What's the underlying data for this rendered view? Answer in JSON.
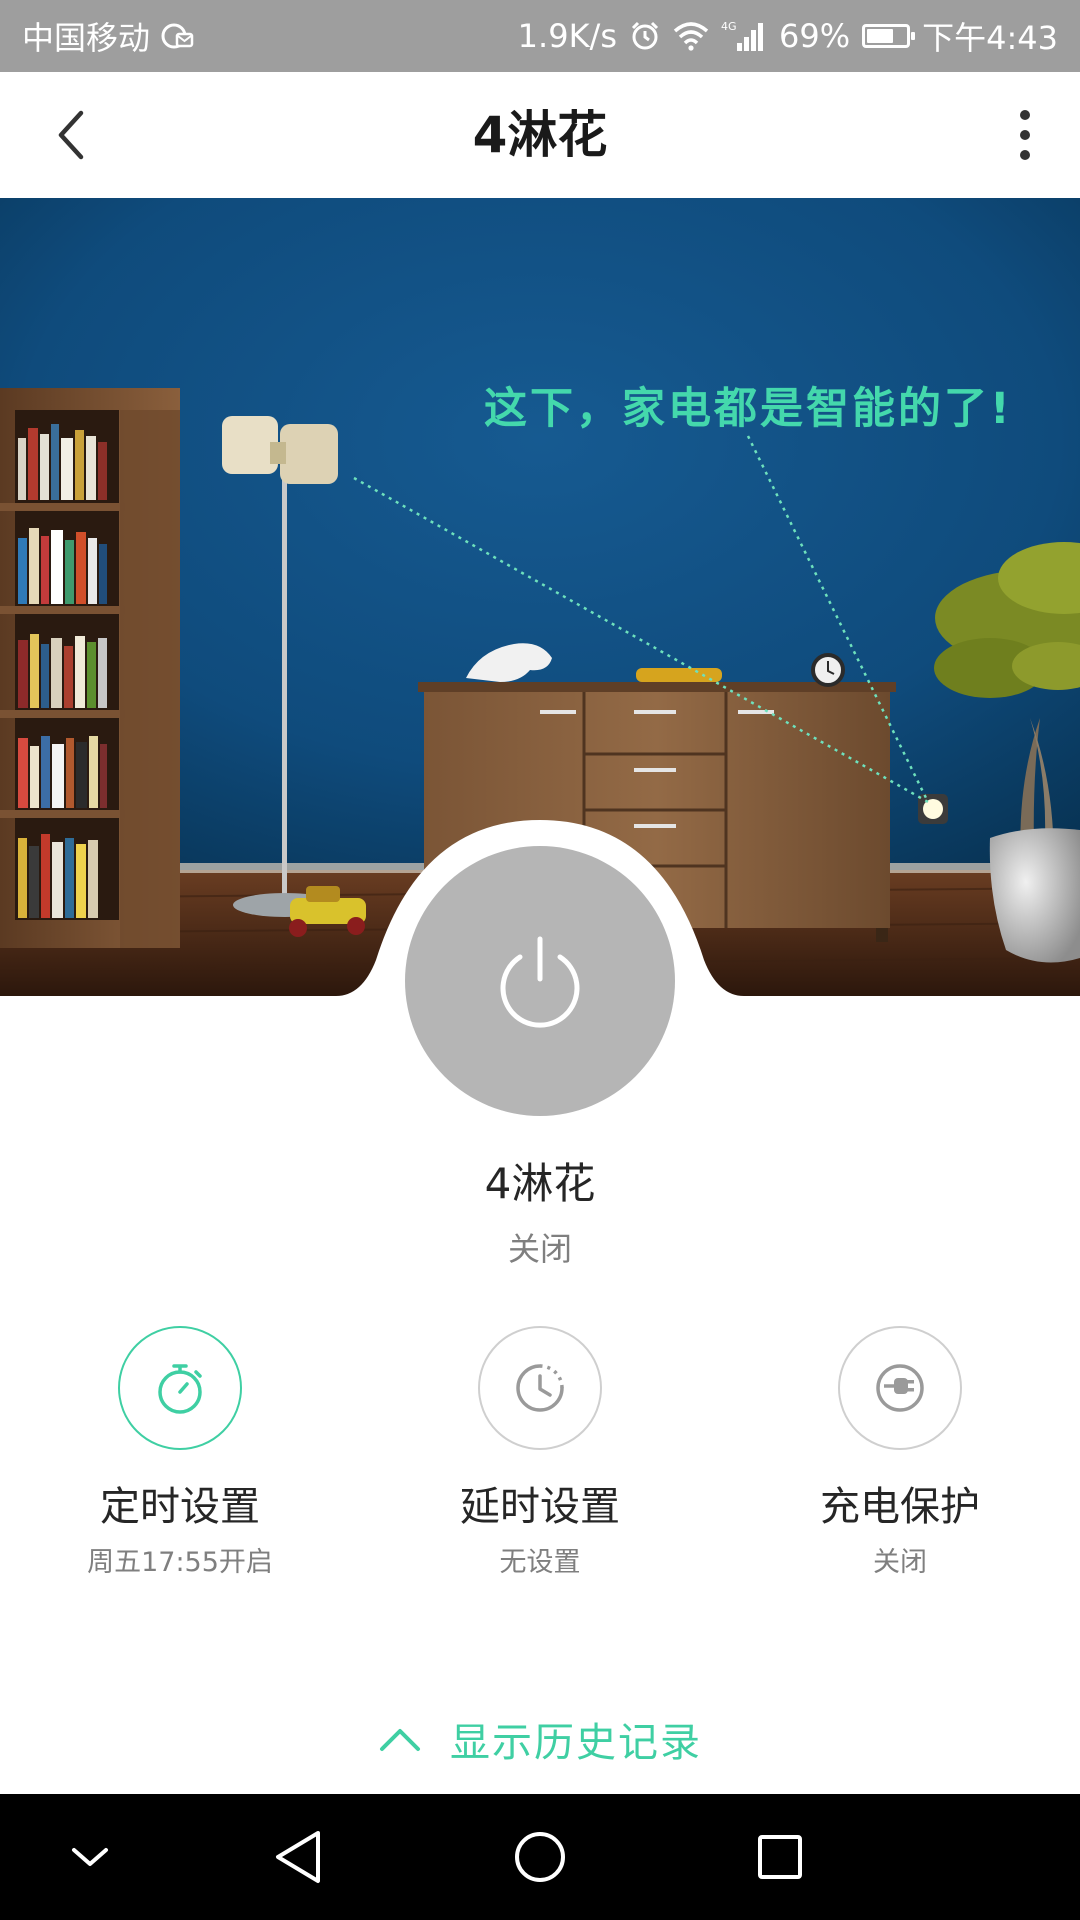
{
  "status_bar": {
    "carrier": "中国移动",
    "net_speed": "1.9K/s",
    "network_type": "4G",
    "battery": "69%",
    "battery_level": 0.69,
    "time": "下午4:43"
  },
  "header": {
    "title": "4淋花"
  },
  "hero": {
    "caption": "这下，家电都是智能的了!"
  },
  "device": {
    "name": "4淋花",
    "status": "关闭"
  },
  "features": [
    {
      "label": "定时设置",
      "sub": "周五17:55开启",
      "icon": "stopwatch-icon",
      "active": true
    },
    {
      "label": "延时设置",
      "sub": "无设置",
      "icon": "clock-icon",
      "active": false
    },
    {
      "label": "充电保护",
      "sub": "关闭",
      "icon": "plug-icon",
      "active": false
    }
  ],
  "history": {
    "label": "显示历史记录"
  },
  "nav": {
    "items": [
      "collapse-down-icon",
      "back-triangle-icon",
      "home-circle-icon",
      "recents-square-icon"
    ]
  },
  "colors": {
    "accent": "#3fcfa3",
    "status_bar": "#9e9e9e",
    "power_button": "#b5b5b5",
    "wall": "#0f4b7c"
  }
}
